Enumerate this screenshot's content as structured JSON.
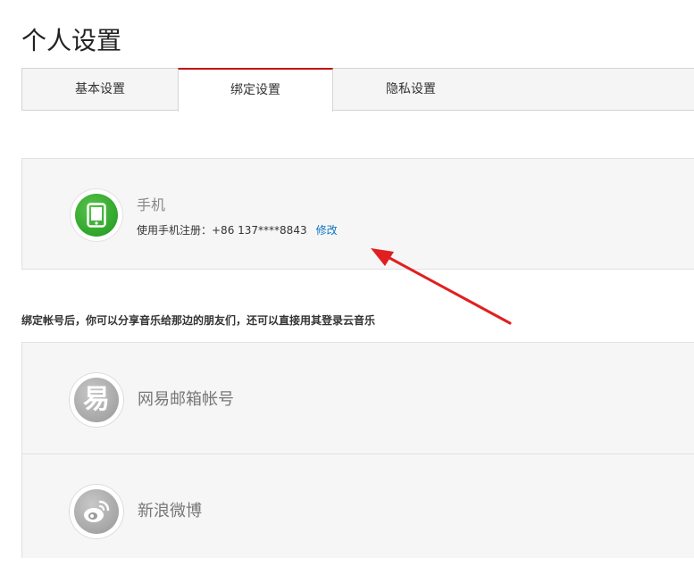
{
  "page": {
    "title": "个人设置"
  },
  "tabs": [
    {
      "label": "基本设置"
    },
    {
      "label": "绑定设置"
    },
    {
      "label": "隐私设置"
    }
  ],
  "active_tab": "绑定设置",
  "phone": {
    "icon": "phone-icon",
    "title": "手机",
    "info": "使用手机注册：+86 137****8843",
    "modify_label": "修改"
  },
  "hint": "绑定帐号后，你可以分享音乐给那边的朋友们，还可以直接用其登录云音乐",
  "bindings": [
    {
      "icon": "netease-mail-icon",
      "glyph": "易",
      "label": "网易邮箱帐号"
    },
    {
      "icon": "weibo-icon",
      "label": "新浪微博"
    }
  ],
  "colors": {
    "accent_red": "#c20c0c",
    "link_blue": "#0c73c2",
    "phone_green": "#2fa52b",
    "arrow_red": "#e02020"
  }
}
